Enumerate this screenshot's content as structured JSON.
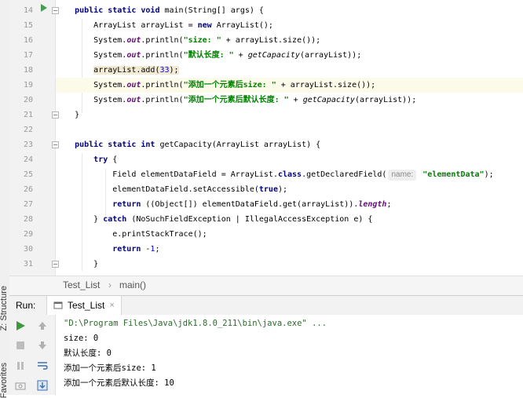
{
  "side_tabs": [
    {
      "label": "Z: Structure"
    },
    {
      "label": "Favorites"
    }
  ],
  "editor": {
    "lines": [
      {
        "num": "14",
        "hl": false,
        "html": "    <span class='kw'>public static void</span> main(String[] args) {"
      },
      {
        "num": "15",
        "hl": false,
        "html": "        ArrayList arrayList = <span class='kw'>new</span> ArrayList();"
      },
      {
        "num": "16",
        "hl": false,
        "html": "        System.<span class='fld'>out</span>.println(<span class='str'>\"size: \"</span> + arrayList.size());"
      },
      {
        "num": "17",
        "hl": false,
        "html": "        System.<span class='fld'>out</span>.println(<span class='str'>\"默认长度: \"</span> + <span class='it'>getCapacity</span>(arrayList));"
      },
      {
        "num": "18",
        "hl": false,
        "html": "        <span class='hlbox'>arrayList.add(<span class='num'>33</span>);</span>"
      },
      {
        "num": "19",
        "hl": true,
        "html": "        System.<span class='fld'>out</span>.println(<span class='str'>\"添加一个元素后size: \"</span> + arrayList.size());"
      },
      {
        "num": "20",
        "hl": false,
        "html": "        System.<span class='fld'>out</span>.println(<span class='str'>\"添加一个元素后默认长度: \"</span> + <span class='it'>getCapacity</span>(arrayList));"
      },
      {
        "num": "21",
        "hl": false,
        "html": "    }"
      },
      {
        "num": "22",
        "hl": false,
        "html": ""
      },
      {
        "num": "23",
        "hl": false,
        "html": "    <span class='kw'>public static int</span> getCapacity(ArrayList arrayList) {"
      },
      {
        "num": "24",
        "hl": false,
        "html": "        <span class='kw'>try</span> {"
      },
      {
        "num": "25",
        "hl": false,
        "html": "            Field elementDataField = ArrayList.<span class='kw'>class</span>.getDeclaredField(<span class='hint'>name:</span> <span class='str'>\"elementData\"</span>);"
      },
      {
        "num": "26",
        "hl": false,
        "html": "            elementDataField.setAccessible(<span class='kw'>true</span>);"
      },
      {
        "num": "27",
        "hl": false,
        "html": "            <span class='kw'>return</span> ((Object[]) elementDataField.get(arrayList)).<span class='fld'>length</span>;"
      },
      {
        "num": "28",
        "hl": false,
        "html": "        } <span class='kw'>catch</span> (NoSuchFieldException | IllegalAccessException e) {"
      },
      {
        "num": "29",
        "hl": false,
        "html": "            e.printStackTrace();"
      },
      {
        "num": "30",
        "hl": false,
        "html": "            <span class='kw'>return</span> -<span class='num'>1</span>;"
      },
      {
        "num": "31",
        "hl": false,
        "html": "        }"
      }
    ]
  },
  "breadcrumb": {
    "file": "Test_List",
    "sep": "›",
    "method": "main()"
  },
  "run_panel": {
    "label": "Run:",
    "tab_label": "Test_List",
    "close": "×"
  },
  "console": {
    "lines": [
      {
        "text": "\"D:\\Program Files\\Java\\jdk1.8.0_211\\bin\\java.exe\" ...",
        "cls": "cmd"
      },
      {
        "text": "size: 0",
        "cls": ""
      },
      {
        "text": "默认长度: 0",
        "cls": ""
      },
      {
        "text": "添加一个元素后size: 1",
        "cls": ""
      },
      {
        "text": "添加一个元素后默认长度: 10",
        "cls": ""
      }
    ]
  }
}
